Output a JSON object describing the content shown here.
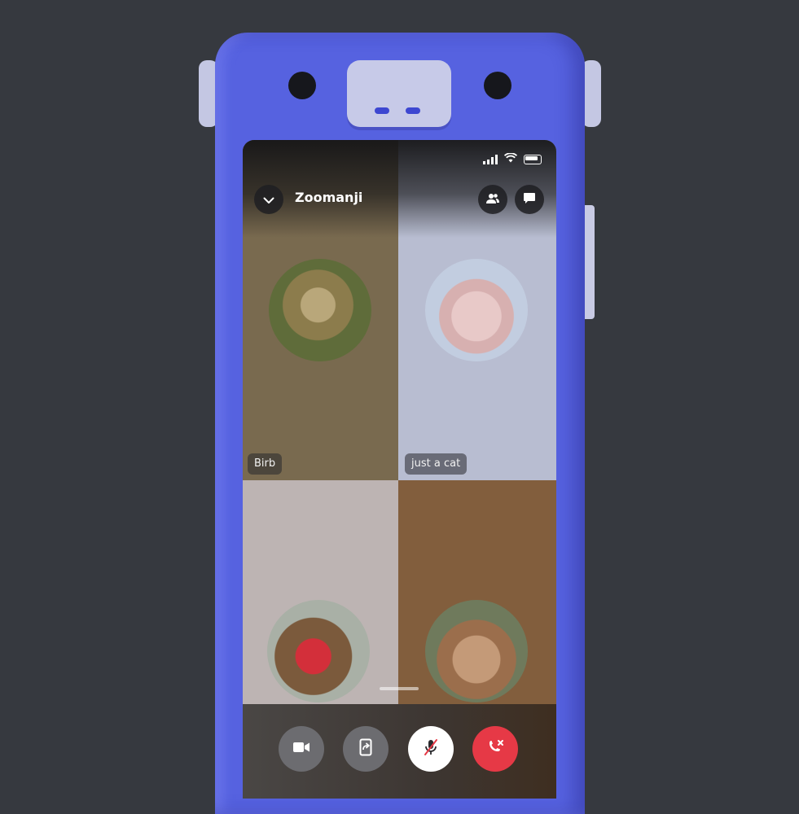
{
  "call": {
    "title": "Zoomanji"
  },
  "participants": [
    {
      "name": "Birb"
    },
    {
      "name": "just a cat"
    }
  ],
  "icons": {
    "back": "chevron-down-icon",
    "people": "people-icon",
    "chat": "chat-icon",
    "video": "video-camera-icon",
    "share": "screen-share-icon",
    "mute": "microphone-muted-icon",
    "hangup": "end-call-icon"
  },
  "colors": {
    "phone_body": "#5662e0",
    "background": "#36393f",
    "end_call": "#e63946"
  }
}
